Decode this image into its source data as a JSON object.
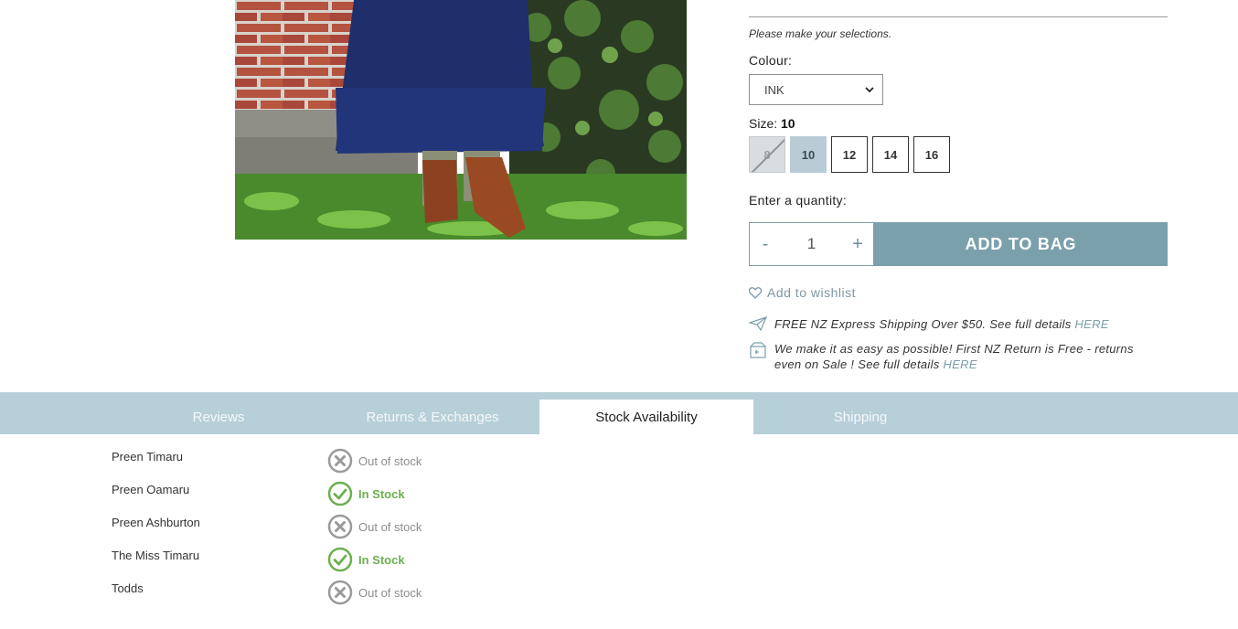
{
  "product": {
    "image_alt": "Model wearing navy tiered skirt and brown boots",
    "selection_prompt": "Please make your selections.",
    "colour_label": "Colour:",
    "colour_selected": "INK",
    "size_label": "Size:",
    "size_selected": "10",
    "sizes": [
      {
        "label": "8",
        "state": "unavailable"
      },
      {
        "label": "10",
        "state": "selected"
      },
      {
        "label": "12",
        "state": "available"
      },
      {
        "label": "14",
        "state": "available"
      },
      {
        "label": "16",
        "state": "available"
      }
    ],
    "quantity_label": "Enter a quantity:",
    "quantity_minus": "-",
    "quantity_value": "1",
    "quantity_plus": "+",
    "add_to_bag": "ADD TO BAG",
    "wishlist": "Add to wishlist",
    "shipping_text": "FREE NZ Express Shipping Over $50. See full details ",
    "shipping_link": "HERE",
    "returns_text": "We make it as easy as possible! First NZ Return is Free - returns even on Sale ! See full details ",
    "returns_link": "HERE"
  },
  "tabs": [
    {
      "label": "Reviews",
      "active": false
    },
    {
      "label": "Returns & Exchanges",
      "active": false
    },
    {
      "label": "Stock Availability",
      "active": true
    },
    {
      "label": "Shipping",
      "active": false
    }
  ],
  "stock": [
    {
      "store": "Preen Timaru",
      "status": "Out of stock",
      "in_stock": false
    },
    {
      "store": "Preen Oamaru",
      "status": "In Stock",
      "in_stock": true
    },
    {
      "store": "Preen Ashburton",
      "status": "Out of stock",
      "in_stock": false
    },
    {
      "store": "The Miss Timaru",
      "status": "In Stock",
      "in_stock": true
    },
    {
      "store": "Todds",
      "status": "Out of stock",
      "in_stock": false
    }
  ],
  "colors": {
    "accent": "#7aa0ac",
    "tab_bar": "#b7cfd9",
    "size_selected": "#b9ccd5",
    "in_stock": "#6cb04f",
    "out_of_stock": "#8c8c8c"
  }
}
